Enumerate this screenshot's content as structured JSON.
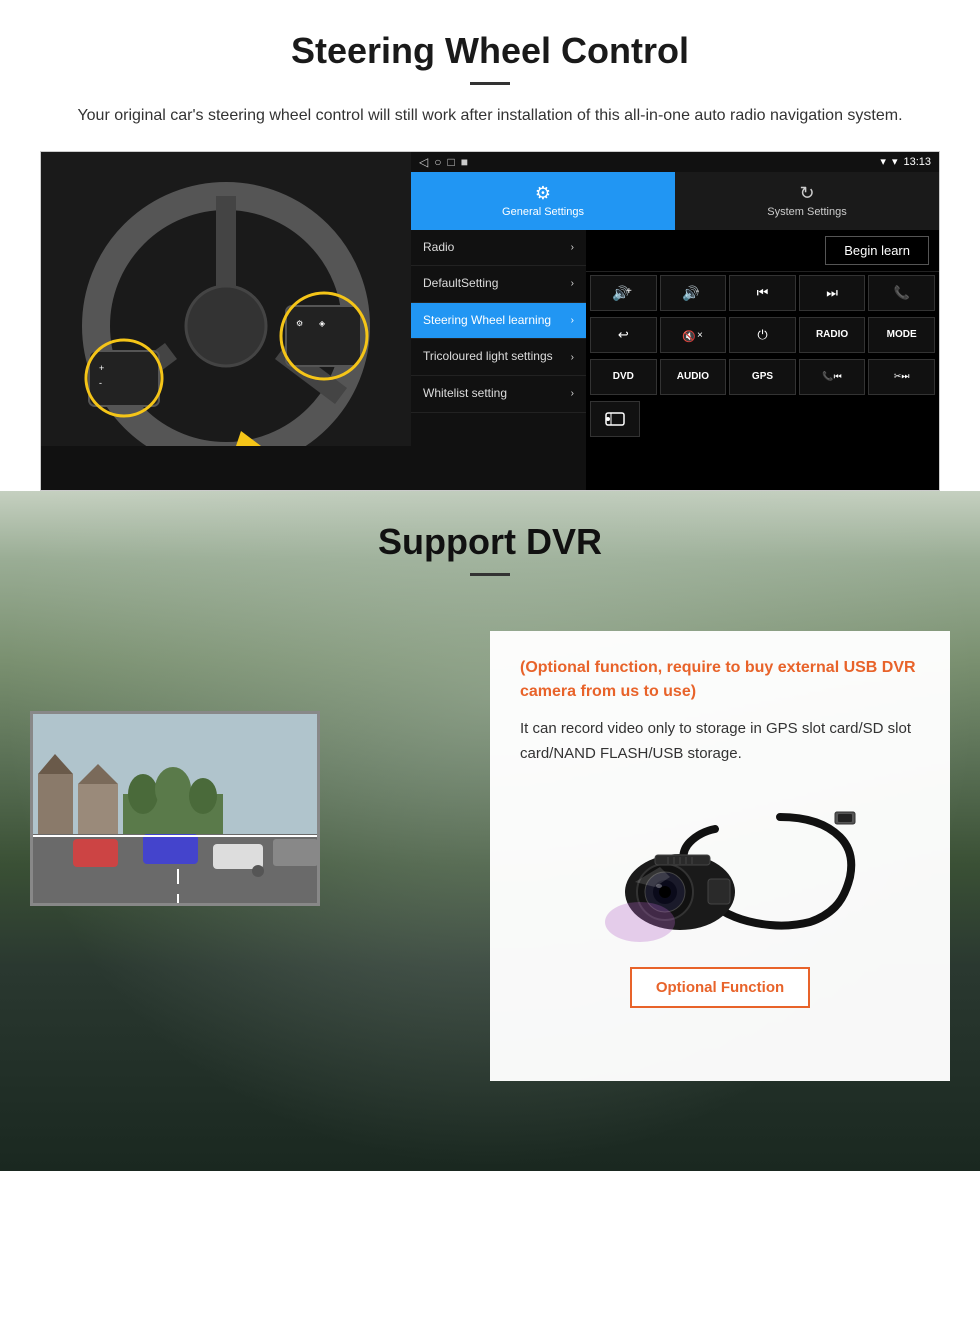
{
  "page": {
    "section1": {
      "title": "Steering Wheel Control",
      "subtitle": "Your original car's steering wheel control will still work after installation of this all-in-one auto radio navigation system.",
      "android_ui": {
        "status_bar": {
          "nav_icons": [
            "◁",
            "○",
            "□",
            "■"
          ],
          "signal": "▾",
          "wifi": "▾",
          "time": "13:13"
        },
        "tab_general": {
          "icon": "⚙",
          "label": "General Settings"
        },
        "tab_system": {
          "icon": "↻",
          "label": "System Settings"
        },
        "menu_items": [
          {
            "label": "Radio",
            "active": false
          },
          {
            "label": "DefaultSetting",
            "active": false
          },
          {
            "label": "Steering Wheel learning",
            "active": true
          },
          {
            "label": "Tricoloured light settings",
            "active": false
          },
          {
            "label": "Whitelist setting",
            "active": false
          }
        ],
        "begin_learn_label": "Begin learn",
        "control_rows": [
          [
            "🔊+",
            "🔊-",
            "⏮",
            "⏭",
            "📞"
          ],
          [
            "↩",
            "🔇×",
            "⏻",
            "RADIO",
            "MODE"
          ],
          [
            "DVD",
            "AUDIO",
            "GPS",
            "📞⏮",
            "✂⏭"
          ],
          [
            "📋"
          ]
        ]
      }
    },
    "section2": {
      "title": "Support DVR",
      "optional_text": "(Optional function, require to buy external USB DVR camera from us to use)",
      "desc_text": "It can record video only to storage in GPS slot card/SD slot card/NAND FLASH/USB storage.",
      "optional_btn": "Optional Function"
    }
  }
}
